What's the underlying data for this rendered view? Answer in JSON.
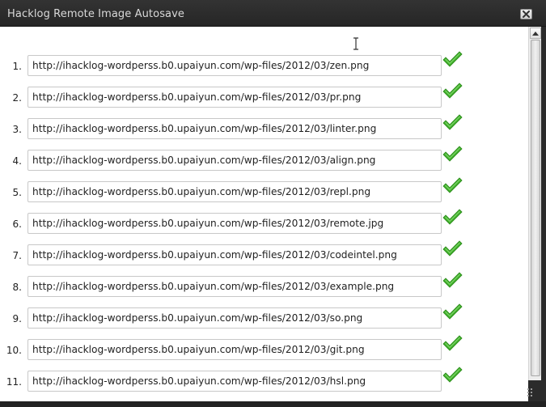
{
  "window": {
    "title": "Hacklog Remote Image Autosave",
    "close_icon": "close-icon"
  },
  "items": [
    {
      "num": "1.",
      "url": "http://ihacklog-wordperss.b0.upaiyun.com/wp-files/2012/03/zen.png",
      "status": "check-icon"
    },
    {
      "num": "2.",
      "url": "http://ihacklog-wordperss.b0.upaiyun.com/wp-files/2012/03/pr.png",
      "status": "check-icon"
    },
    {
      "num": "3.",
      "url": "http://ihacklog-wordperss.b0.upaiyun.com/wp-files/2012/03/linter.png",
      "status": "check-icon"
    },
    {
      "num": "4.",
      "url": "http://ihacklog-wordperss.b0.upaiyun.com/wp-files/2012/03/align.png",
      "status": "check-icon"
    },
    {
      "num": "5.",
      "url": "http://ihacklog-wordperss.b0.upaiyun.com/wp-files/2012/03/repl.png",
      "status": "check-icon"
    },
    {
      "num": "6.",
      "url": "http://ihacklog-wordperss.b0.upaiyun.com/wp-files/2012/03/remote.jpg",
      "status": "check-icon"
    },
    {
      "num": "7.",
      "url": "http://ihacklog-wordperss.b0.upaiyun.com/wp-files/2012/03/codeintel.png",
      "status": "check-icon"
    },
    {
      "num": "8.",
      "url": "http://ihacklog-wordperss.b0.upaiyun.com/wp-files/2012/03/example.png",
      "status": "check-icon"
    },
    {
      "num": "9.",
      "url": "http://ihacklog-wordperss.b0.upaiyun.com/wp-files/2012/03/so.png",
      "status": "check-icon"
    },
    {
      "num": "10.",
      "url": "http://ihacklog-wordperss.b0.upaiyun.com/wp-files/2012/03/git.png",
      "status": "check-icon"
    },
    {
      "num": "11.",
      "url": "http://ihacklog-wordperss.b0.upaiyun.com/wp-files/2012/03/hsl.png",
      "status": "check-icon"
    }
  ],
  "colors": {
    "titlebar": "#2b2b2b",
    "title_text": "#d9d9d9",
    "content_bg": "#ffffff",
    "check_green": "#3fae29"
  }
}
